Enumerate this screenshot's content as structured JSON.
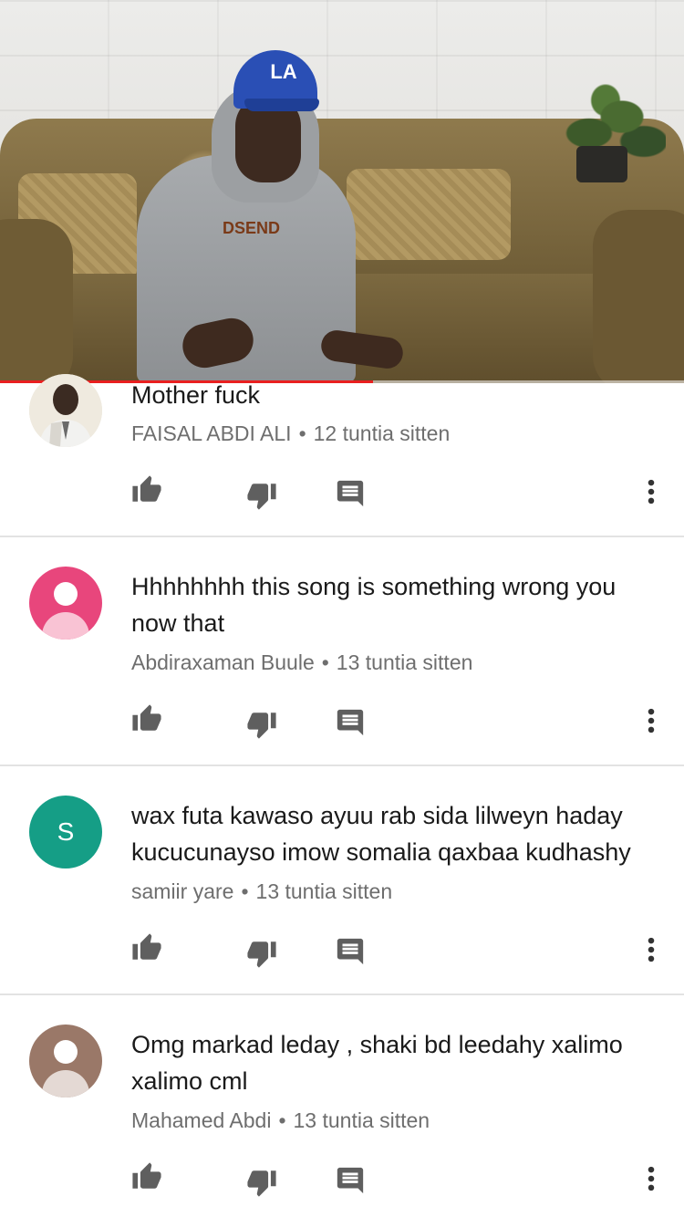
{
  "video": {
    "progress_fraction": 0.545,
    "cap_logo_text": "LA",
    "shirt_logo_text": "DSEND"
  },
  "colors": {
    "progress_red": "#e91f1f",
    "avatar_pink": "#e8467c",
    "avatar_teal": "#159e86",
    "avatar_brown": "#9a7868",
    "icon_gray": "#5f5f5f",
    "meta_gray": "#6e6e6e"
  },
  "comments": [
    {
      "text": "Mother fuck",
      "author": "FAISAL ABDI ALI",
      "separator": "•",
      "time": "12 tuntia sitten",
      "avatar_type": "photo"
    },
    {
      "text": "Hhhhhhhh this song is something wrong you now that",
      "author": "Abdiraxaman Buule",
      "separator": "•",
      "time": "13 tuntia sitten",
      "avatar_type": "default",
      "avatar_color": "#e8467c"
    },
    {
      "text": "wax futa kawaso ayuu rab sida lilweyn haday kucucunayso imow somalia qaxbaa kudhashy",
      "author": "samiir yare",
      "separator": "•",
      "time": "13 tuntia sitten",
      "avatar_type": "letter",
      "avatar_letter": "S",
      "avatar_color": "#159e86"
    },
    {
      "text": "Omg markad leday , shaki bd leedahy xalimo xalimo cml",
      "author": "Mahamed Abdi",
      "separator": "•",
      "time": "13 tuntia sitten",
      "avatar_type": "default",
      "avatar_color": "#9a7868"
    }
  ],
  "icons": {
    "like": "thumbs-up-icon",
    "dislike": "thumbs-down-icon",
    "reply": "reply-icon",
    "more": "more-vertical-icon"
  }
}
